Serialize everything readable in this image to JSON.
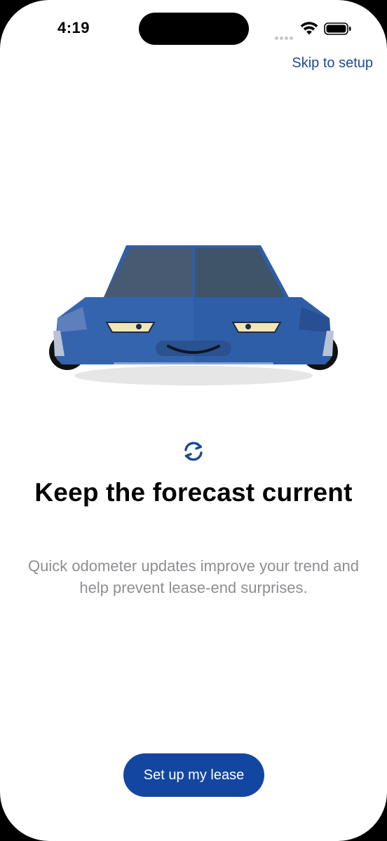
{
  "status_bar": {
    "time": "4:19"
  },
  "header": {
    "skip_label": "Skip to setup"
  },
  "onboarding": {
    "illustration_icon": "smiling-car-icon",
    "feature_icon": "sync-icon",
    "title": "Keep the forecast current",
    "subtitle": "Quick odometer updates improve your trend and help prevent lease-end surprises."
  },
  "footer": {
    "cta_label": "Set up my lease"
  },
  "colors": {
    "accent": "#1346a0",
    "link": "#1a4a99",
    "car_body": "#2f5ea8",
    "subtitle_text": "#8e8e93"
  }
}
